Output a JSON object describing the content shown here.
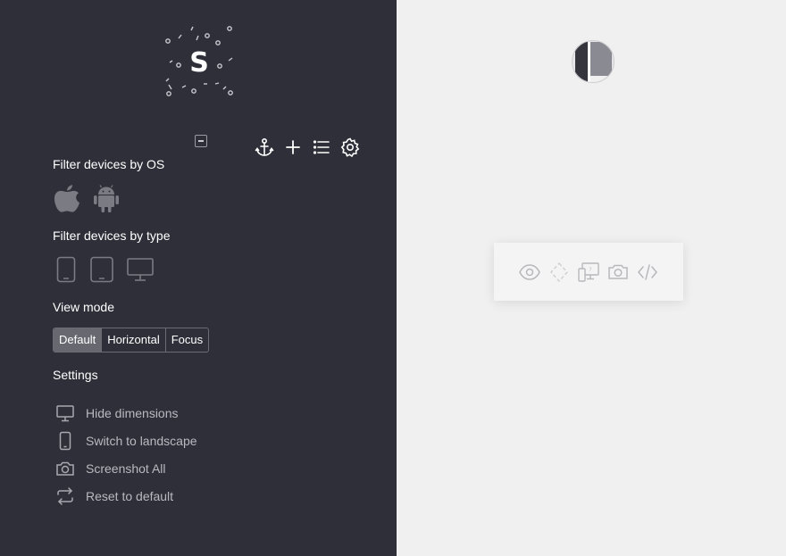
{
  "app": {
    "logo_letter": "S",
    "logo_icon": "sizzy-logo-confetti"
  },
  "sidebar": {
    "toolbar": {
      "collapse_icon": "collapse-icon",
      "icons": [
        "anchor-icon",
        "plus-icon",
        "list-icon",
        "gear-icon"
      ]
    },
    "filter_os": {
      "title": "Filter devices by OS",
      "icons": [
        "apple-icon",
        "android-icon"
      ]
    },
    "filter_type": {
      "title": "Filter devices by type",
      "icons": [
        "phone-icon",
        "tablet-icon",
        "desktop-icon"
      ]
    },
    "view_mode": {
      "title": "View mode",
      "options": [
        "Default",
        "Horizontal",
        "Focus"
      ],
      "selected": "Default"
    },
    "settings": {
      "title": "Settings",
      "items": [
        {
          "label": "Hide dimensions",
          "icon": "monitor-icon"
        },
        {
          "label": "Switch to landscape",
          "icon": "phone-icon"
        },
        {
          "label": "Screenshot All",
          "icon": "camera-icon"
        },
        {
          "label": "Reset to default",
          "icon": "refresh-icon"
        }
      ]
    }
  },
  "main": {
    "avatar_icon": "user-avatar",
    "device_toolbar": {
      "icons": [
        "eye-icon",
        "rotate-icon",
        "devices-icon",
        "camera-icon",
        "code-icon"
      ]
    }
  },
  "colors": {
    "sidebar_bg": "#2e2f38",
    "main_bg": "#f0f0f0",
    "active_segment": "#676870"
  }
}
